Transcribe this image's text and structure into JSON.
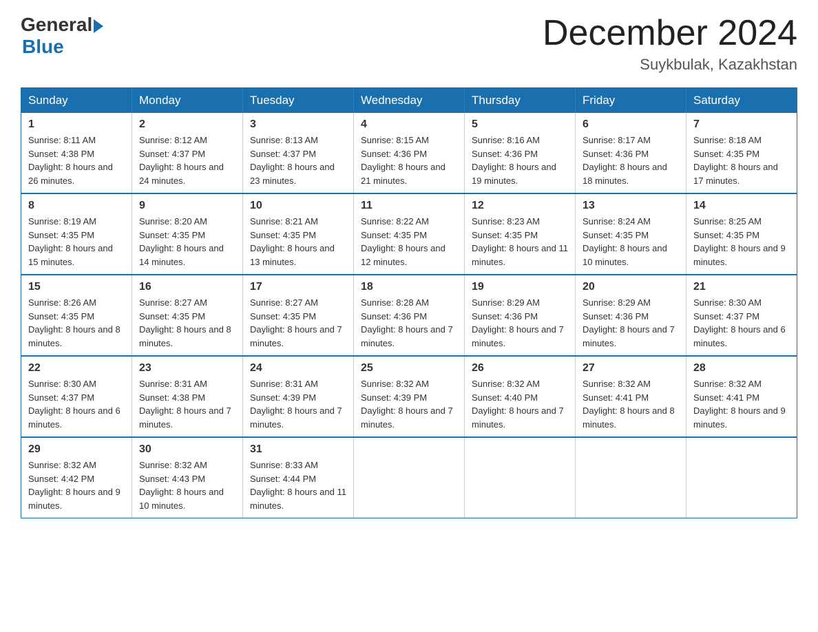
{
  "logo": {
    "general": "General",
    "blue": "Blue"
  },
  "title": {
    "month_year": "December 2024",
    "location": "Suykbulak, Kazakhstan"
  },
  "weekdays": [
    "Sunday",
    "Monday",
    "Tuesday",
    "Wednesday",
    "Thursday",
    "Friday",
    "Saturday"
  ],
  "weeks": [
    [
      {
        "day": "1",
        "sunrise": "8:11 AM",
        "sunset": "4:38 PM",
        "daylight": "8 hours and 26 minutes."
      },
      {
        "day": "2",
        "sunrise": "8:12 AM",
        "sunset": "4:37 PM",
        "daylight": "8 hours and 24 minutes."
      },
      {
        "day": "3",
        "sunrise": "8:13 AM",
        "sunset": "4:37 PM",
        "daylight": "8 hours and 23 minutes."
      },
      {
        "day": "4",
        "sunrise": "8:15 AM",
        "sunset": "4:36 PM",
        "daylight": "8 hours and 21 minutes."
      },
      {
        "day": "5",
        "sunrise": "8:16 AM",
        "sunset": "4:36 PM",
        "daylight": "8 hours and 19 minutes."
      },
      {
        "day": "6",
        "sunrise": "8:17 AM",
        "sunset": "4:36 PM",
        "daylight": "8 hours and 18 minutes."
      },
      {
        "day": "7",
        "sunrise": "8:18 AM",
        "sunset": "4:35 PM",
        "daylight": "8 hours and 17 minutes."
      }
    ],
    [
      {
        "day": "8",
        "sunrise": "8:19 AM",
        "sunset": "4:35 PM",
        "daylight": "8 hours and 15 minutes."
      },
      {
        "day": "9",
        "sunrise": "8:20 AM",
        "sunset": "4:35 PM",
        "daylight": "8 hours and 14 minutes."
      },
      {
        "day": "10",
        "sunrise": "8:21 AM",
        "sunset": "4:35 PM",
        "daylight": "8 hours and 13 minutes."
      },
      {
        "day": "11",
        "sunrise": "8:22 AM",
        "sunset": "4:35 PM",
        "daylight": "8 hours and 12 minutes."
      },
      {
        "day": "12",
        "sunrise": "8:23 AM",
        "sunset": "4:35 PM",
        "daylight": "8 hours and 11 minutes."
      },
      {
        "day": "13",
        "sunrise": "8:24 AM",
        "sunset": "4:35 PM",
        "daylight": "8 hours and 10 minutes."
      },
      {
        "day": "14",
        "sunrise": "8:25 AM",
        "sunset": "4:35 PM",
        "daylight": "8 hours and 9 minutes."
      }
    ],
    [
      {
        "day": "15",
        "sunrise": "8:26 AM",
        "sunset": "4:35 PM",
        "daylight": "8 hours and 8 minutes."
      },
      {
        "day": "16",
        "sunrise": "8:27 AM",
        "sunset": "4:35 PM",
        "daylight": "8 hours and 8 minutes."
      },
      {
        "day": "17",
        "sunrise": "8:27 AM",
        "sunset": "4:35 PM",
        "daylight": "8 hours and 7 minutes."
      },
      {
        "day": "18",
        "sunrise": "8:28 AM",
        "sunset": "4:36 PM",
        "daylight": "8 hours and 7 minutes."
      },
      {
        "day": "19",
        "sunrise": "8:29 AM",
        "sunset": "4:36 PM",
        "daylight": "8 hours and 7 minutes."
      },
      {
        "day": "20",
        "sunrise": "8:29 AM",
        "sunset": "4:36 PM",
        "daylight": "8 hours and 7 minutes."
      },
      {
        "day": "21",
        "sunrise": "8:30 AM",
        "sunset": "4:37 PM",
        "daylight": "8 hours and 6 minutes."
      }
    ],
    [
      {
        "day": "22",
        "sunrise": "8:30 AM",
        "sunset": "4:37 PM",
        "daylight": "8 hours and 6 minutes."
      },
      {
        "day": "23",
        "sunrise": "8:31 AM",
        "sunset": "4:38 PM",
        "daylight": "8 hours and 7 minutes."
      },
      {
        "day": "24",
        "sunrise": "8:31 AM",
        "sunset": "4:39 PM",
        "daylight": "8 hours and 7 minutes."
      },
      {
        "day": "25",
        "sunrise": "8:32 AM",
        "sunset": "4:39 PM",
        "daylight": "8 hours and 7 minutes."
      },
      {
        "day": "26",
        "sunrise": "8:32 AM",
        "sunset": "4:40 PM",
        "daylight": "8 hours and 7 minutes."
      },
      {
        "day": "27",
        "sunrise": "8:32 AM",
        "sunset": "4:41 PM",
        "daylight": "8 hours and 8 minutes."
      },
      {
        "day": "28",
        "sunrise": "8:32 AM",
        "sunset": "4:41 PM",
        "daylight": "8 hours and 9 minutes."
      }
    ],
    [
      {
        "day": "29",
        "sunrise": "8:32 AM",
        "sunset": "4:42 PM",
        "daylight": "8 hours and 9 minutes."
      },
      {
        "day": "30",
        "sunrise": "8:32 AM",
        "sunset": "4:43 PM",
        "daylight": "8 hours and 10 minutes."
      },
      {
        "day": "31",
        "sunrise": "8:33 AM",
        "sunset": "4:44 PM",
        "daylight": "8 hours and 11 minutes."
      },
      null,
      null,
      null,
      null
    ]
  ]
}
